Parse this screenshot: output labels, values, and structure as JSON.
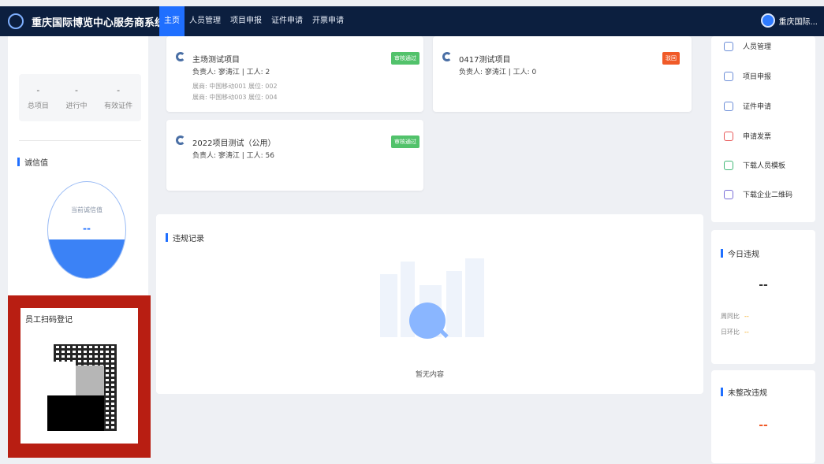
{
  "header": {
    "app_title": "重庆国际博览中心服务商系统",
    "nav": [
      "主页",
      "人员管理",
      "项目申报",
      "证件申请",
      "开票申请"
    ],
    "user_name": "重庆国际..."
  },
  "left": {
    "stats": [
      {
        "value": "-",
        "label": "总项目"
      },
      {
        "value": "-",
        "label": "进行中"
      },
      {
        "value": "-",
        "label": "有效证件"
      }
    ],
    "credit": {
      "title": "诚信值",
      "gauge_label": "当前诚信值",
      "gauge_value": "--",
      "gauge_fill_fraction": 0.4
    },
    "qr": {
      "title": "员工扫码登记"
    }
  },
  "projects": [
    {
      "name": "主场测试项目",
      "meta": "负责人: 寥涛江 | 工人: 2",
      "sub": [
        "展商: 中国移动001  展位: 002",
        "展商: 中国移动003  展位: 004"
      ],
      "tag": "审核通过",
      "tag_color": "#52c26b"
    },
    {
      "name": "0417测试项目",
      "meta": "负责人: 寥涛江 | 工人: 0",
      "sub": [],
      "tag": "驳回",
      "tag_color": "#f05a28"
    },
    {
      "name": "2022项目测试（公用）",
      "meta": "负责人: 寥涛江 | 工人: 56",
      "sub": [],
      "tag": "审核通过",
      "tag_color": "#52c26b"
    }
  ],
  "violations": {
    "title": "违规记录",
    "empty_text": "暂无内容"
  },
  "quick_links": [
    {
      "label": "人员管理",
      "icon": "file-icon",
      "color": "#6c8ed8"
    },
    {
      "label": "项目申报",
      "icon": "file-icon",
      "color": "#6c8ed8"
    },
    {
      "label": "证件申请",
      "icon": "file-icon",
      "color": "#6c8ed8"
    },
    {
      "label": "申请发票",
      "icon": "invoice-icon",
      "color": "#e85a5a"
    },
    {
      "label": "下载人员模板",
      "icon": "download-icon",
      "color": "#43b877"
    },
    {
      "label": "下载企业二维码",
      "icon": "qrcode-icon",
      "color": "#7a6fd8"
    }
  ],
  "today": {
    "title": "今日违规",
    "value": "--",
    "week_label": "周同比",
    "week_value": "--",
    "day_label": "日环比",
    "day_value": "--"
  },
  "unfixed": {
    "title": "未整改违规",
    "value": "--"
  }
}
